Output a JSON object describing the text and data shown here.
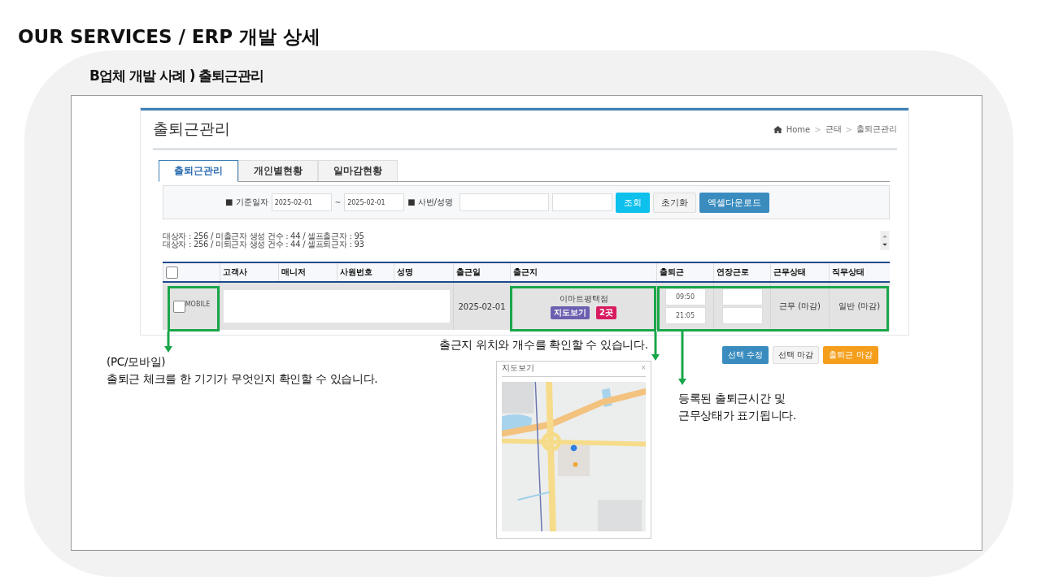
{
  "heading": "OUR SERVICES / ERP 개발 상세",
  "subtitle": "B업체 개발 사례 ) 출퇴근관리",
  "app": {
    "title": "출퇴근관리",
    "breadcrumb": [
      {
        "text": "Home",
        "kind": "link"
      },
      {
        "text": ">",
        "kind": "sep"
      },
      {
        "text": "근태",
        "kind": "link"
      },
      {
        "text": ">",
        "kind": "sep"
      },
      {
        "text": "출퇴근관리",
        "kind": "link"
      }
    ],
    "tabs": [
      {
        "label": "출퇴근관리",
        "selected": true
      },
      {
        "label": "개인별현황",
        "selected": false
      },
      {
        "label": "일마감현황",
        "selected": false
      }
    ],
    "search": {
      "date_label": "■ 기준일자",
      "date_from": "2025-02-01",
      "date_separator": "~",
      "date_to": "2025-02-01",
      "name_label": "■ 사번/성명",
      "buttons": [
        {
          "label": "조회",
          "kind": "info"
        },
        {
          "label": "초기화",
          "kind": "default"
        },
        {
          "label": "엑셀다운로드",
          "kind": "primary"
        }
      ]
    },
    "summary": [
      "대상자 : 256 / 미출근자 생성 건수 : 44 / 셀프출근자 : 95",
      "대상자 : 256 / 미퇴근자 생성 건수 : 44 / 셀프퇴근자 : 93"
    ],
    "table": {
      "header_checked": false,
      "columns": [
        "고객사",
        "매니저",
        "사원번호",
        "성명",
        "출근일",
        "출근지",
        "출퇴근",
        "연장근로",
        "근무상태",
        "직무상태"
      ],
      "rows": [
        {
          "checked": false,
          "device": "MOBILE",
          "date": "2025-02-01",
          "location": "이마트평택점",
          "map_button": "지도보기",
          "location_count": "2곳",
          "clock_in": "09:50",
          "clock_out": "21:05",
          "work_status": "근무 (마감)",
          "duty_status": "일반 (마감)"
        }
      ]
    },
    "actions": [
      {
        "label": "선택 수정",
        "kind": "primary"
      },
      {
        "label": "선택 마감",
        "kind": "default"
      },
      {
        "label": "출퇴근 마감",
        "kind": "warning"
      }
    ]
  },
  "annotations": [
    {
      "lines": [
        "(PC/모바일)",
        "출퇴근 체크를 한 기기가 무엇인지 확인할 수 있습니다."
      ]
    },
    {
      "lines": [
        "출근지 위치와 개수를 확인할 수 있습니다."
      ]
    },
    {
      "lines": [
        "등록된 출퇴근시간 및",
        "근무상태가 표기됩니다."
      ]
    }
  ],
  "map_popup": {
    "title": "지도보기",
    "close": "×"
  }
}
